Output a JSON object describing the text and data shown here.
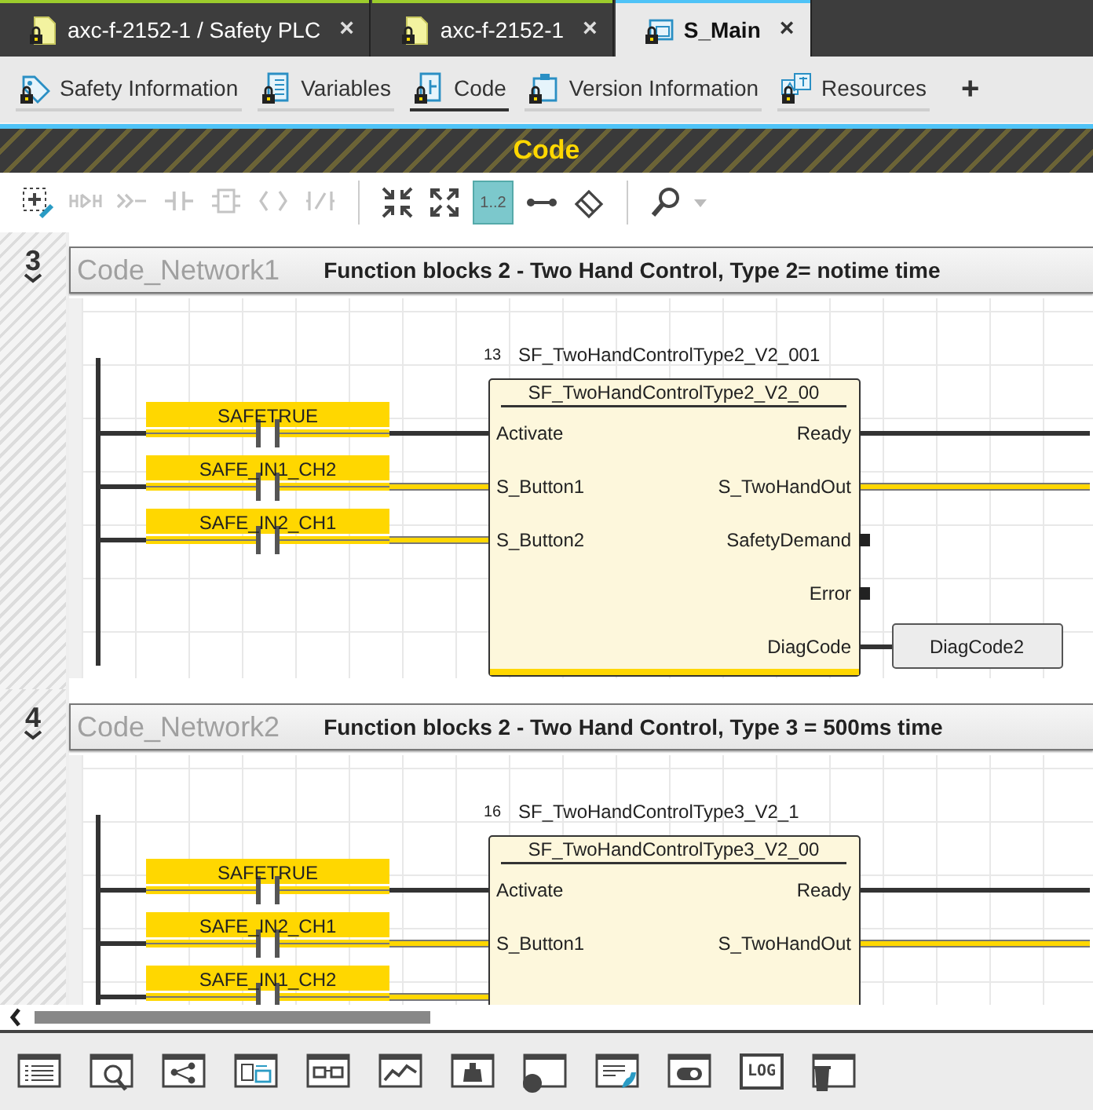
{
  "document_tabs": [
    {
      "label": "axc-f-2152-1 / Safety PLC",
      "close": "×",
      "selected": false,
      "kind": "document"
    },
    {
      "label": "axc-f-2152-1",
      "close": "×",
      "selected": false,
      "kind": "document"
    },
    {
      "label": "S_Main",
      "close": "×",
      "selected": true,
      "kind": "program"
    }
  ],
  "view_tabs": [
    {
      "label": "Safety Information",
      "selected": false,
      "kind": "tag"
    },
    {
      "label": "Variables",
      "selected": false,
      "kind": "list"
    },
    {
      "label": "Code",
      "selected": true,
      "kind": "code"
    },
    {
      "label": "Version Information",
      "selected": false,
      "kind": "clipboard"
    },
    {
      "label": "Resources",
      "selected": false,
      "kind": "translate"
    }
  ],
  "add_tab": "+",
  "section_title": "Code",
  "toolbar": [
    {
      "kind": "add",
      "disabled": false,
      "selected": false
    },
    {
      "kind": "coil",
      "disabled": true,
      "selected": false
    },
    {
      "kind": "branch",
      "disabled": true,
      "selected": false
    },
    {
      "kind": "contact",
      "disabled": true,
      "selected": false
    },
    {
      "kind": "block",
      "disabled": true,
      "selected": false
    },
    {
      "kind": "brackets",
      "disabled": true,
      "selected": false
    },
    {
      "kind": "negated",
      "disabled": true,
      "selected": false
    },
    {
      "kind": "separator"
    },
    {
      "kind": "shrink",
      "disabled": false,
      "selected": false
    },
    {
      "kind": "expand",
      "disabled": false,
      "selected": false
    },
    {
      "kind": "numbering",
      "label": "1..2",
      "disabled": false,
      "selected": true
    },
    {
      "kind": "connect",
      "disabled": false,
      "selected": false
    },
    {
      "kind": "eraser",
      "disabled": false,
      "selected": false
    },
    {
      "kind": "separator"
    },
    {
      "kind": "search",
      "disabled": false,
      "selected": false
    }
  ],
  "networks": [
    {
      "number": "3",
      "name": "Code_Network1",
      "title": "Function blocks 2 - Two Hand Control, Type 2= notime time",
      "contacts": [
        {
          "variable": "SAFETRUE",
          "safe": false
        },
        {
          "variable": "SAFE_IN1_CH2",
          "safe": true
        },
        {
          "variable": "SAFE_IN2_CH1",
          "safe": true
        }
      ],
      "block": {
        "index": "13",
        "instance": "SF_TwoHandControlType2_V2_001",
        "type": "SF_TwoHandControlType2_V2_00",
        "inputs": [
          "Activate",
          "S_Button1",
          "S_Button2"
        ],
        "outputs": [
          {
            "name": "Ready",
            "kind": "wire"
          },
          {
            "name": "S_TwoHandOut",
            "kind": "safe"
          },
          {
            "name": "SafetyDemand",
            "kind": "open"
          },
          {
            "name": "Error",
            "kind": "open"
          },
          {
            "name": "DiagCode",
            "kind": "variable",
            "variable": "DiagCode2"
          }
        ]
      }
    },
    {
      "number": "4",
      "name": "Code_Network2",
      "title": "Function blocks 2 - Two Hand Control, Type 3 = 500ms time",
      "contacts": [
        {
          "variable": "SAFETRUE",
          "safe": false
        },
        {
          "variable": "SAFE_IN2_CH1",
          "safe": true
        },
        {
          "variable": "SAFE_IN1_CH2",
          "safe": true
        }
      ],
      "block": {
        "index": "16",
        "instance": "SF_TwoHandControlType3_V2_1",
        "type": "SF_TwoHandControlType3_V2_00",
        "inputs": [
          "Activate",
          "S_Button1"
        ],
        "outputs": [
          {
            "name": "Ready",
            "kind": "wire"
          },
          {
            "name": "S_TwoHandOut",
            "kind": "safe"
          }
        ]
      }
    }
  ],
  "bottom_toolbar": [
    {
      "kind": "list"
    },
    {
      "kind": "search-window"
    },
    {
      "kind": "share"
    },
    {
      "kind": "compare"
    },
    {
      "kind": "glasses"
    },
    {
      "kind": "chart"
    },
    {
      "kind": "weight"
    },
    {
      "kind": "record"
    },
    {
      "kind": "phone"
    },
    {
      "kind": "toggle"
    },
    {
      "kind": "log",
      "label": "LOG"
    },
    {
      "kind": "trash"
    }
  ]
}
